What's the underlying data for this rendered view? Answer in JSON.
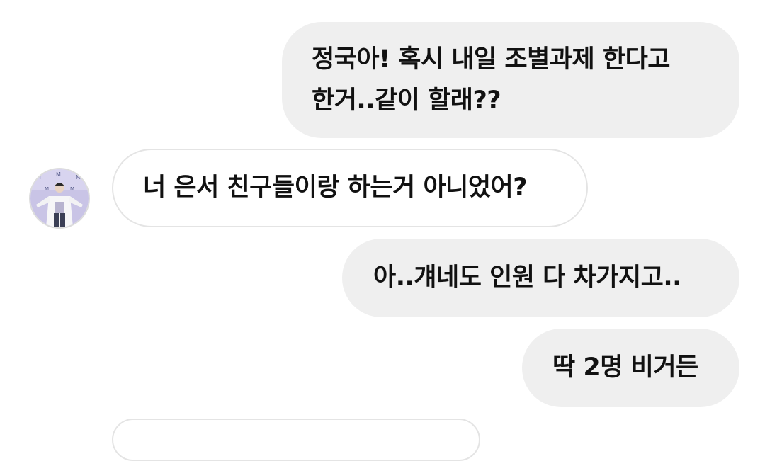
{
  "messages": [
    {
      "sender": "me",
      "lines": [
        "정국아! 혹시 내일 조별과제 한다고",
        "한거..같이 할래??"
      ]
    },
    {
      "sender": "other",
      "text": "너 은서 친구들이랑 하는거 아니었어?"
    },
    {
      "sender": "me",
      "text": "아..걔네도 인원 다 차가지고.."
    },
    {
      "sender": "me",
      "text": "딱 2명 비거든"
    }
  ],
  "avatar": {
    "icon": "profile-photo-avatar",
    "background": "#c9c4e6"
  },
  "colors": {
    "sent_bubble": "#efefef",
    "received_border": "#e4e4e4"
  }
}
